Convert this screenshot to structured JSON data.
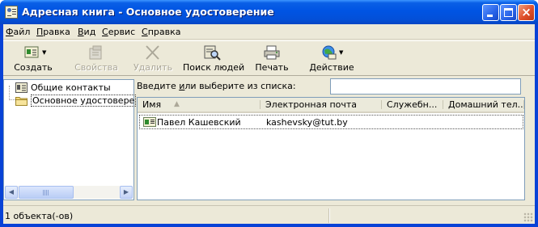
{
  "window": {
    "title": "Адресная книга - Основное удостоверение",
    "controls": {
      "minimize": "minimize",
      "maximize": "maximize",
      "close": "×"
    }
  },
  "menu": {
    "items": [
      {
        "u": "Ф",
        "rest": "айл"
      },
      {
        "u": "П",
        "rest": "равка"
      },
      {
        "u": "В",
        "rest": "ид"
      },
      {
        "u": "С",
        "rest": "ервис"
      },
      {
        "u": "С",
        "rest": "правка"
      }
    ]
  },
  "toolbar": {
    "create": "Создать",
    "properties": "Свойства",
    "delete": "Удалить",
    "find_people": "Поиск людей",
    "print": "Печать",
    "action": "Действие",
    "icons": {
      "create": "new-contact-icon",
      "properties": "properties-icon",
      "delete": "delete-icon",
      "find_people": "find-people-icon",
      "print": "printer-icon",
      "action": "action-globe-icon"
    }
  },
  "tree": {
    "items": [
      {
        "label": "Общие контакты",
        "icon": "shared-contacts-icon"
      },
      {
        "label": "Основное удостовере",
        "icon": "folder-icon",
        "selected": true
      }
    ]
  },
  "search": {
    "prompt_before": "Введите ",
    "prompt_u": "и",
    "prompt_after": "ли выберите из списка:",
    "value": ""
  },
  "list": {
    "columns": [
      "Имя",
      "Электронная почта",
      "Служебн...",
      "Домашний тел..."
    ],
    "rows": [
      {
        "name": "Павел Кашевский",
        "email": "kashevsky@tut.by",
        "work": "",
        "home": ""
      }
    ]
  },
  "status": {
    "text": "1 объекта(-ов)"
  },
  "colors": {
    "titlebar": "#0054e3",
    "client": "#ece9d8",
    "border": "#7f9db9"
  }
}
